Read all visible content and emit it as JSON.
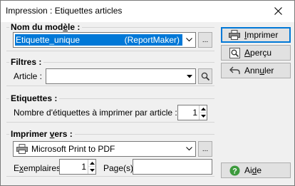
{
  "window": {
    "title": "Impression : Etiquettes articles"
  },
  "model_group": {
    "label_pre": "Nom du mod",
    "label_ul": "è",
    "label_post": "le :",
    "combo_name": "Etiquette_unique",
    "combo_type": "(ReportMaker)",
    "browse_label": "..."
  },
  "filters_group": {
    "label": "Filtres :",
    "article_label": "Article :",
    "article_value": ""
  },
  "labels_group": {
    "label": "Etiquettes :",
    "count_label": "Nombre d'étiquettes à imprimer par article :",
    "count_value": "1"
  },
  "print_group": {
    "label_pre": "Imprimer ",
    "label_ul": "v",
    "label_post": "ers :",
    "printer": "Microsoft Print to PDF",
    "browse_label": "...",
    "copies_pre": "E",
    "copies_ul": "x",
    "copies_post": "emplaires",
    "copies_value": "1",
    "pages_label": "Page(s)",
    "pages_value": ""
  },
  "actions": {
    "print_ul": "I",
    "print_rest": "mprimer",
    "preview_ul": "A",
    "preview_rest": "perçu",
    "cancel_pre": "Ann",
    "cancel_ul": "u",
    "cancel_post": "ler",
    "help_pre": "Ai",
    "help_ul": "d",
    "help_post": "e"
  },
  "icons": {
    "print": "printer-icon",
    "preview": "magnifier-icon",
    "cancel": "undo-arrow-icon",
    "help": "help-question-icon",
    "close": "close-icon"
  },
  "colors": {
    "selection": "#0078d7",
    "help_green": "#3c9a3c"
  }
}
